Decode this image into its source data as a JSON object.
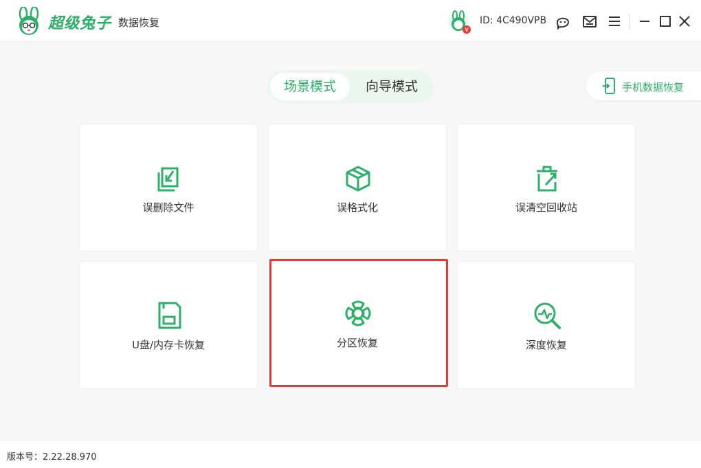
{
  "app": {
    "brand_name": "超级兔子",
    "brand_subtitle": "数据恢复",
    "user_id": "ID: 4C490VPB",
    "avatar_badge": "V"
  },
  "window_controls": {
    "icons": [
      "support-icon",
      "message-icon",
      "menu-icon",
      "minimize-icon",
      "maximize-icon",
      "close-icon"
    ]
  },
  "mode_tabs": [
    {
      "label": "场景模式",
      "active": true
    },
    {
      "label": "向导模式",
      "active": false
    }
  ],
  "phone_recovery": {
    "label": "手机数据恢复"
  },
  "cards": [
    {
      "label": "误删除文件",
      "icon": "deleted-file-icon"
    },
    {
      "label": "误格式化",
      "icon": "format-box-icon"
    },
    {
      "label": "误清空回收站",
      "icon": "recycle-bin-icon"
    },
    {
      "label": "U盘/内存卡恢复",
      "icon": "sd-card-icon"
    },
    {
      "label": "分区恢复",
      "icon": "partition-icon",
      "selected": true
    },
    {
      "label": "深度恢复",
      "icon": "deep-scan-icon"
    }
  ],
  "footer": {
    "version": "版本号：2.22.28.970"
  },
  "colors": {
    "accent": "#2bb067",
    "highlight_border": "#e53a32"
  }
}
